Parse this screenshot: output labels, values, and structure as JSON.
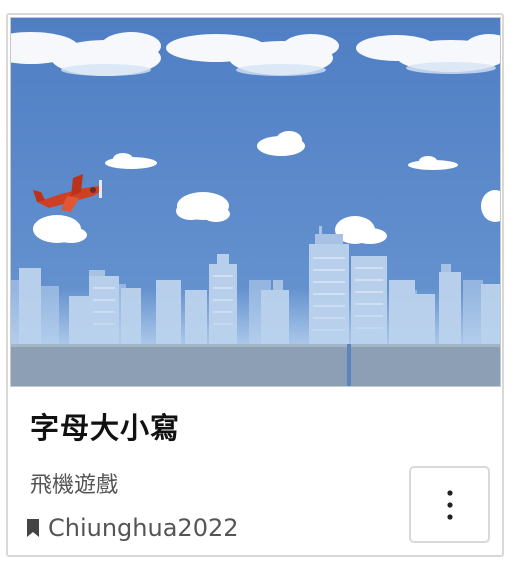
{
  "card": {
    "title": "字母大小寫",
    "subtitle": "飛機遊戲",
    "author": "Chiunghua2022",
    "author_icon": "bookmark-icon",
    "menu_icon": "more-vertical-icon"
  },
  "thumbnail": {
    "sky_color": "#5b88c8",
    "ground_color": "#8c9db1",
    "plane_color": "#d9452b"
  }
}
